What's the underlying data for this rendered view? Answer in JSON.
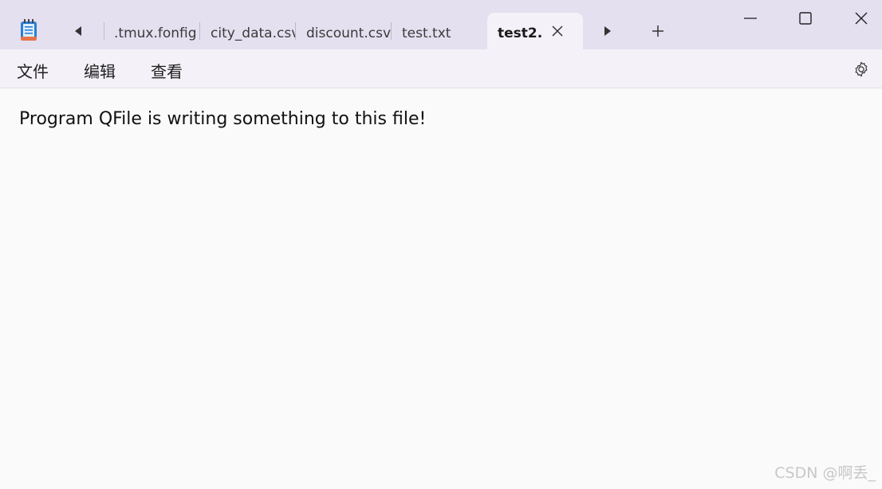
{
  "tabs": [
    {
      "label": ".tmux.fonfig."
    },
    {
      "label": "city_data.csv"
    },
    {
      "label": "discount.csv"
    },
    {
      "label": "test.txt"
    },
    {
      "label": "test2."
    }
  ],
  "menu": {
    "file": "文件",
    "edit": "编辑",
    "view": "查看"
  },
  "editor": {
    "content": "Program QFile is writing something to this file!"
  },
  "watermark": "CSDN @啊丢_",
  "colors": {
    "titlebar": "#e4e0f0",
    "active_tab": "#f4f2f8",
    "app_icon": "#2a7fd4"
  },
  "icons": {
    "app": "notepad-icon",
    "prev": "scroll-left-icon",
    "next": "scroll-right-icon",
    "close_tab": "close-icon",
    "new_tab": "plus-icon",
    "minimize": "minimize-icon",
    "maximize": "maximize-icon",
    "close_window": "close-icon",
    "settings": "gear-icon"
  }
}
